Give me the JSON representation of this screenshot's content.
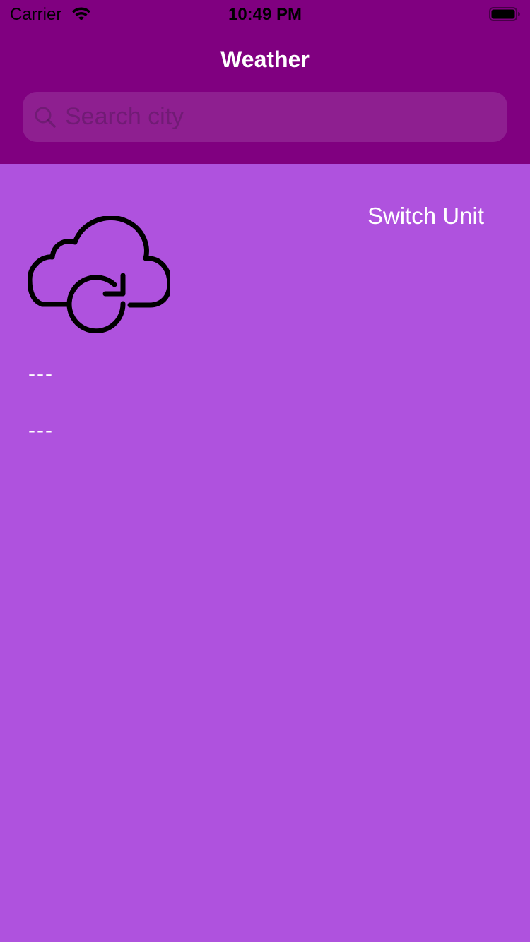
{
  "status_bar": {
    "carrier": "Carrier",
    "time": "10:49 PM",
    "wifi_icon": "wifi-icon",
    "battery_icon": "battery-icon"
  },
  "nav": {
    "title": "Weather"
  },
  "search": {
    "placeholder": "Search city",
    "value": "",
    "icon": "search-icon"
  },
  "main": {
    "switch_unit_label": "Switch Unit",
    "weather_icon": "cloud-refresh-icon",
    "temperature": "---",
    "city": "---"
  },
  "colors": {
    "header_background": "#800080",
    "content_background": "#AF52DE",
    "text_primary": "#FFFFFF"
  }
}
